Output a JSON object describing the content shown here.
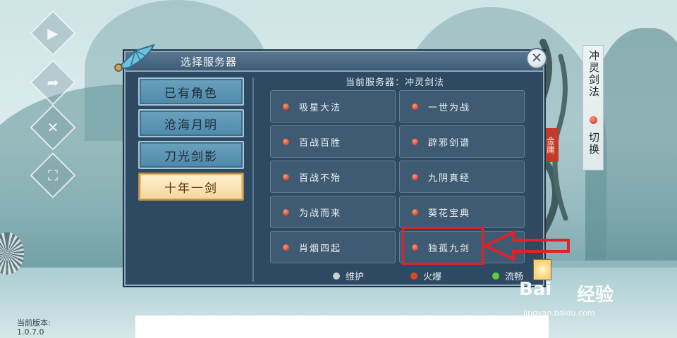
{
  "dialog": {
    "title": "选择服务器",
    "current_server_label": "当前服务器：冲灵剑法",
    "close_symbol": "✕"
  },
  "categories": [
    {
      "label": "已有角色",
      "active": false
    },
    {
      "label": "沧海月明",
      "active": false
    },
    {
      "label": "刀光剑影",
      "active": false
    },
    {
      "label": "十年一剑",
      "active": true
    }
  ],
  "servers": [
    {
      "name": "吸星大法",
      "status": "hot"
    },
    {
      "name": "一世为战",
      "status": "hot"
    },
    {
      "name": "百战百胜",
      "status": "hot"
    },
    {
      "name": "辟邪剑谱",
      "status": "hot"
    },
    {
      "name": "百战不殆",
      "status": "hot"
    },
    {
      "name": "九阴真经",
      "status": "hot"
    },
    {
      "name": "为战而来",
      "status": "hot"
    },
    {
      "name": "葵花宝典",
      "status": "hot"
    },
    {
      "name": "肖烟四起",
      "status": "hot"
    },
    {
      "name": "独孤九剑",
      "status": "hot",
      "highlighted": true
    }
  ],
  "legend": [
    {
      "label": "维护",
      "color": "#c9d0d4"
    },
    {
      "label": "火爆",
      "color": "#e0452a"
    },
    {
      "label": "流畅",
      "color": "#5ccf3a"
    }
  ],
  "right_panel": {
    "server_name": "冲灵剑法",
    "switch_label": "切换",
    "seal_text": "金庸"
  },
  "side_icons": [
    "video-icon",
    "share-icon",
    "tools-icon",
    "scan-icon"
  ],
  "version": {
    "label": "当前版本:",
    "value": "1.0.7.0"
  },
  "watermark": {
    "logo": "Bai",
    "text": "经验",
    "url": "jingyan.baidu.com"
  },
  "colors": {
    "annotation_red": "#e0212a",
    "dialog_bg": "#2d4a62",
    "hot_dot": "#e0452a"
  }
}
